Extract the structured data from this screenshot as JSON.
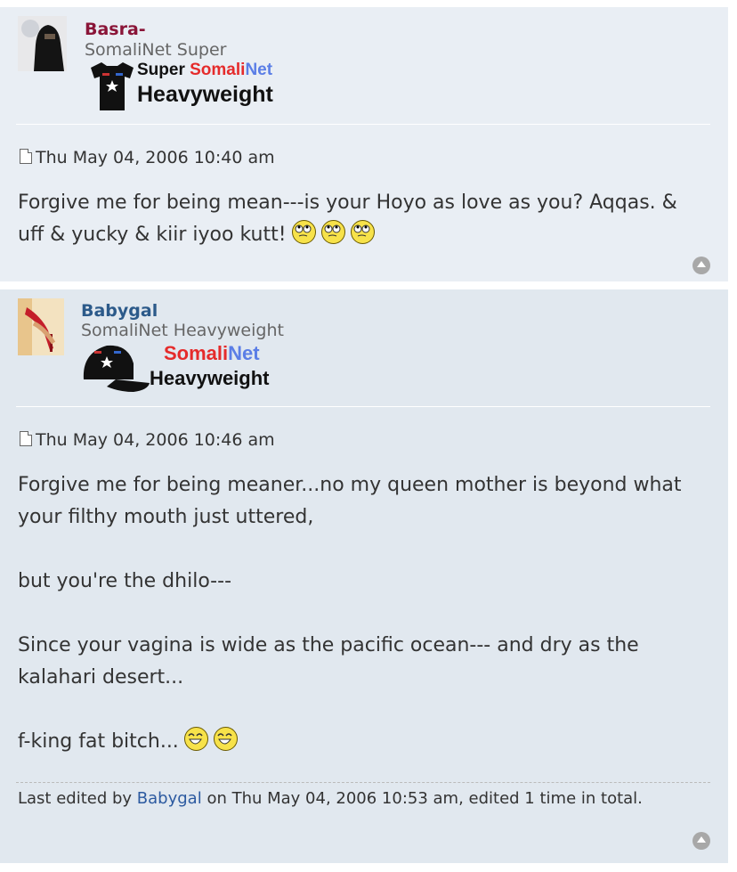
{
  "posts": [
    {
      "author": "Basra-",
      "author_color": "#8a1538",
      "rank_title": "SomaliNet Super",
      "rank_image": {
        "line1_black": "Super ",
        "line1_red": "Somali",
        "line1_blue": "Net",
        "line2": "Heavyweight"
      },
      "timestamp": "Thu May 04, 2006 10:40 am",
      "content_lines": [
        "Forgive me for being mean---is your Hoyo as love as you? Aqqas. &",
        "uff & yucky & kiir iyoo kutt!"
      ],
      "smileys": [
        "rolleyes",
        "rolleyes",
        "rolleyes"
      ]
    },
    {
      "author": "Babygal",
      "author_color": "#2c5a8a",
      "rank_title": "SomaliNet Heavyweight",
      "rank_image": {
        "line1_red": "Somali",
        "line1_blue": "Net",
        "line2": "Heavyweight"
      },
      "timestamp": "Thu May 04, 2006 10:46 am",
      "paragraphs": [
        "Forgive me for being meaner...no my queen mother is beyond what your filthy mouth just uttered,",
        "but you're the dhilo---",
        "Since your vagina is wide as the pacific ocean--- and dry as the kalahari desert...",
        "f-king fat bitch..."
      ],
      "smileys": [
        "laugh",
        "laugh"
      ],
      "edit_notice": {
        "prefix": "Last edited by ",
        "user": "Babygal",
        "suffix": " on Thu May 04, 2006 10:53 am, edited 1 time in total."
      }
    }
  ]
}
